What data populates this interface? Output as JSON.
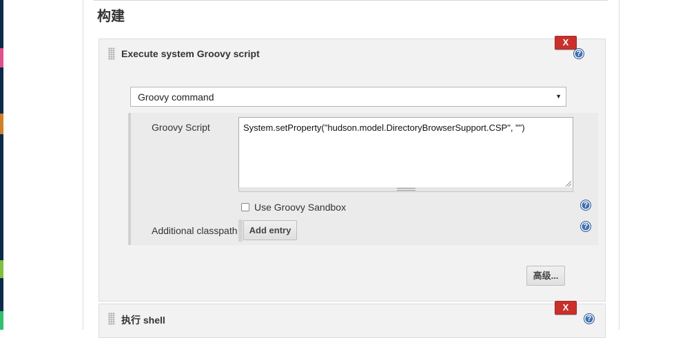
{
  "section": {
    "title": "构建"
  },
  "steps": [
    {
      "title": "Execute system Groovy script",
      "delete_label": "X",
      "help_label": "?",
      "command_select": {
        "selected": "Groovy command",
        "caret": "▼"
      },
      "script": {
        "label": "Groovy Script",
        "value": "System.setProperty(\"hudson.model.DirectoryBrowserSupport.CSP\", \"\")"
      },
      "sandbox": {
        "label": "Use Groovy Sandbox",
        "checked": false,
        "help_label": "?"
      },
      "classpath": {
        "label": "Additional classpath",
        "add_label": "Add entry",
        "help_label": "?"
      },
      "advanced_label": "高级..."
    },
    {
      "title": "执行 shell",
      "delete_label": "X",
      "help_label": "?"
    }
  ],
  "colors": {
    "delete": "#c9302c",
    "help": "#3f6fae",
    "panel_bg": "#f2f2f2",
    "inner_bg": "#ebebeb"
  }
}
